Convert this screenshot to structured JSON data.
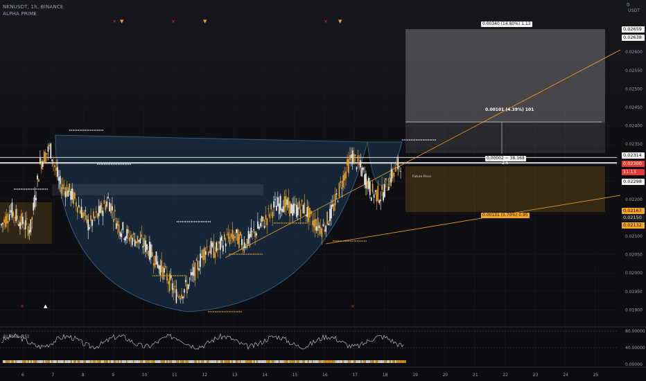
{
  "header": {
    "symbol": "NKNUSDT, 1h, BINANCE",
    "indicator": "ALPHA PRIME",
    "sub_indicator": "ALPHA RSI"
  },
  "top_right": {
    "zero": "0",
    "currency": "USDT"
  },
  "colors": {
    "up": "#ffffff",
    "down": "#f5a623",
    "accent": "#f5a623",
    "cup": "#1f3a55",
    "grid": "#1a1c22",
    "red": "#e53935",
    "line": "#f5a623"
  },
  "price_axis_ticks": [
    "0.02600",
    "0.02550",
    "0.02500",
    "0.02450",
    "0.02400",
    "0.02350",
    "0.02250",
    "0.02200",
    "0.02100",
    "0.02050",
    "0.02000",
    "0.01950",
    "0.01900"
  ],
  "price_tags": [
    {
      "text": "0.02659",
      "style": "white"
    },
    {
      "text": "0.02638",
      "style": "white"
    },
    {
      "text": "0.02314",
      "style": "white"
    },
    {
      "text": "0.02300",
      "style": "red"
    },
    {
      "text": "11:13",
      "style": "red"
    },
    {
      "text": "0.02298",
      "style": "white"
    },
    {
      "text": "0.02167",
      "style": "orange"
    },
    {
      "text": "0.02150",
      "style": "dark"
    },
    {
      "text": "0.02132",
      "style": "orange"
    }
  ],
  "rsi_axis": [
    "80.00000",
    "40.00000",
    "0.00000"
  ],
  "date_ticks": [
    "6",
    "7",
    "8",
    "9",
    "10",
    "11",
    "12",
    "13",
    "14",
    "15",
    "16",
    "17",
    "18",
    "19",
    "20",
    "21",
    "22",
    "23",
    "24",
    "25"
  ],
  "labels": {
    "target_top": "0.00340 (14.80%) 1.13",
    "mid_measure": "0.00101 (4.39%) 101",
    "small_box_1": "0.00002 ~ 38.168",
    "small_box_2": "2.6",
    "bottom_measure": "0.00131 (5.70%) 0.95",
    "future_price": "Future Price"
  },
  "markers": {
    "x": "×",
    "tri_down": "▼",
    "tri_up": "▲"
  },
  "chart_data": {
    "type": "candlestick",
    "title": "NKNUSDT, 1h, BINANCE",
    "x_ticks": [
      "6",
      "7",
      "8",
      "9",
      "10",
      "11",
      "12",
      "13",
      "14",
      "15",
      "16",
      "17",
      "18",
      "19",
      "20",
      "21",
      "22",
      "23",
      "24",
      "25"
    ],
    "ylim": [
      0.0188,
      0.0267
    ],
    "close_approx": [
      0.0213,
      0.0217,
      0.0214,
      0.0212,
      0.023,
      0.0234,
      0.0224,
      0.0222,
      0.0218,
      0.0213,
      0.0216,
      0.022,
      0.0213,
      0.021,
      0.0209,
      0.0207,
      0.0203,
      0.0199,
      0.0194,
      0.0196,
      0.0201,
      0.0207,
      0.0206,
      0.0209,
      0.021,
      0.0208,
      0.0211,
      0.0214,
      0.0218,
      0.0219,
      0.0217,
      0.0218,
      0.0214,
      0.0212,
      0.0217,
      0.0225,
      0.0232,
      0.0228,
      0.0222,
      0.0221,
      0.0226,
      0.023
    ],
    "last_price": 0.023,
    "levels": {
      "resistance_1": 0.02314,
      "resistance_2": 0.02298,
      "support_1": 0.02167,
      "support_2": 0.02132,
      "target": 0.02638
    },
    "rsi_series": {
      "name": "ALPHA RSI",
      "ylim": [
        0,
        80
      ],
      "levels": [
        80,
        40,
        0
      ]
    }
  }
}
